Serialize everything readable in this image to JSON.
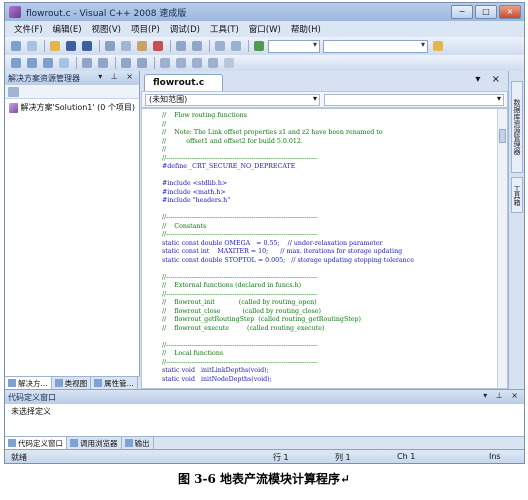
{
  "window": {
    "title": "flowrout.c - Visual C++ 2008 速成版",
    "minimize": "−",
    "maximize": "□",
    "close": "×"
  },
  "menu": [
    "文件(F)",
    "编辑(E)",
    "视图(V)",
    "项目(P)",
    "调试(D)",
    "工具(T)",
    "窗口(W)",
    "帮助(H)"
  ],
  "solution_explorer": {
    "title": "解决方案资源管理器",
    "controls": "▾ ⊥ ×",
    "root_item": "解决方案'Solution1' (0 个项目)",
    "tabs": [
      "解决方...",
      "类视图",
      "属性管..."
    ]
  },
  "editor": {
    "tab_label": "flowrout.c",
    "tab_controls": "▾ ×",
    "scope_combo": "(未知范围)",
    "code_lines": [
      {
        "t": "//    Flow routing functions",
        "c": "cmt"
      },
      {
        "t": "//",
        "c": "cmt"
      },
      {
        "t": "//    Note: The Link offset properties z1 and z2 have been renamed to",
        "c": "cmt"
      },
      {
        "t": "//          offset1 and offset2 for build 5.0.012.",
        "c": "cmt"
      },
      {
        "t": "//",
        "c": "cmt"
      },
      {
        "t": "//-----------------------------------------------------------------------",
        "c": "cmt"
      },
      {
        "t": "#define _CRT_SECURE_NO_DEPRECATE",
        "c": "pp"
      },
      {
        "t": "",
        "c": "txt"
      },
      {
        "t": "#include <stdlib.h>",
        "c": "pp"
      },
      {
        "t": "#include <math.h>",
        "c": "pp"
      },
      {
        "t": "#include \"headers.h\"",
        "c": "pp"
      },
      {
        "t": "",
        "c": "txt"
      },
      {
        "t": "//-----------------------------------------------------------------------",
        "c": "cmt"
      },
      {
        "t": "//    Constants",
        "c": "cmt"
      },
      {
        "t": "//-----------------------------------------------------------------------",
        "c": "cmt"
      },
      {
        "t": "static const double OMEGA   = 0.55;    // under-relaxation parameter",
        "c": "kw"
      },
      {
        "t": "static const int    MAXITER = 10;      // max. iterations for storage updating",
        "c": "kw"
      },
      {
        "t": "static const double STOPTOL = 0.005;   // storage updating stopping tolerance",
        "c": "kw"
      },
      {
        "t": "",
        "c": "txt"
      },
      {
        "t": "//-----------------------------------------------------------------------",
        "c": "cmt"
      },
      {
        "t": "//    External functions (declared in funcs.h)",
        "c": "cmt"
      },
      {
        "t": "//-----------------------------------------------------------------------",
        "c": "cmt"
      },
      {
        "t": "//    flowrout_init            (called by routing_open)",
        "c": "cmt"
      },
      {
        "t": "//    flowrout_close           (called by routing_close)",
        "c": "cmt"
      },
      {
        "t": "//    flowrout_getRoutingStep  (called routing_getRoutingStep)",
        "c": "cmt"
      },
      {
        "t": "//    flowrout_execute         (called routing_execute)",
        "c": "cmt"
      },
      {
        "t": "",
        "c": "txt"
      },
      {
        "t": "//-----------------------------------------------------------------------",
        "c": "cmt"
      },
      {
        "t": "//    Local functions",
        "c": "cmt"
      },
      {
        "t": "//-----------------------------------------------------------------------",
        "c": "cmt"
      },
      {
        "t": "static void   initLinkDepths(void);",
        "c": "kw"
      },
      {
        "t": "static void   initNodeDepths(void);",
        "c": "kw"
      }
    ]
  },
  "right_strip": {
    "tab1": "数据库资源管理器",
    "tab2": "工具箱"
  },
  "code_def_panel": {
    "title": "代码定义窗口",
    "controls": "▾ ⊥ ×",
    "content": "未选择定义",
    "tabs": [
      "代码定义窗口",
      "调用浏览器",
      "输出"
    ]
  },
  "status": {
    "ready": "就绪",
    "line": "行 1",
    "col": "列 1",
    "ch": "Ch 1",
    "mode": "Ins"
  },
  "caption": "图 3-6  地表产流模块计算程序↵",
  "colors": {
    "comment": "#0a7a0a",
    "keyword": "#1818c8",
    "chrome": "#d6e1f1"
  }
}
